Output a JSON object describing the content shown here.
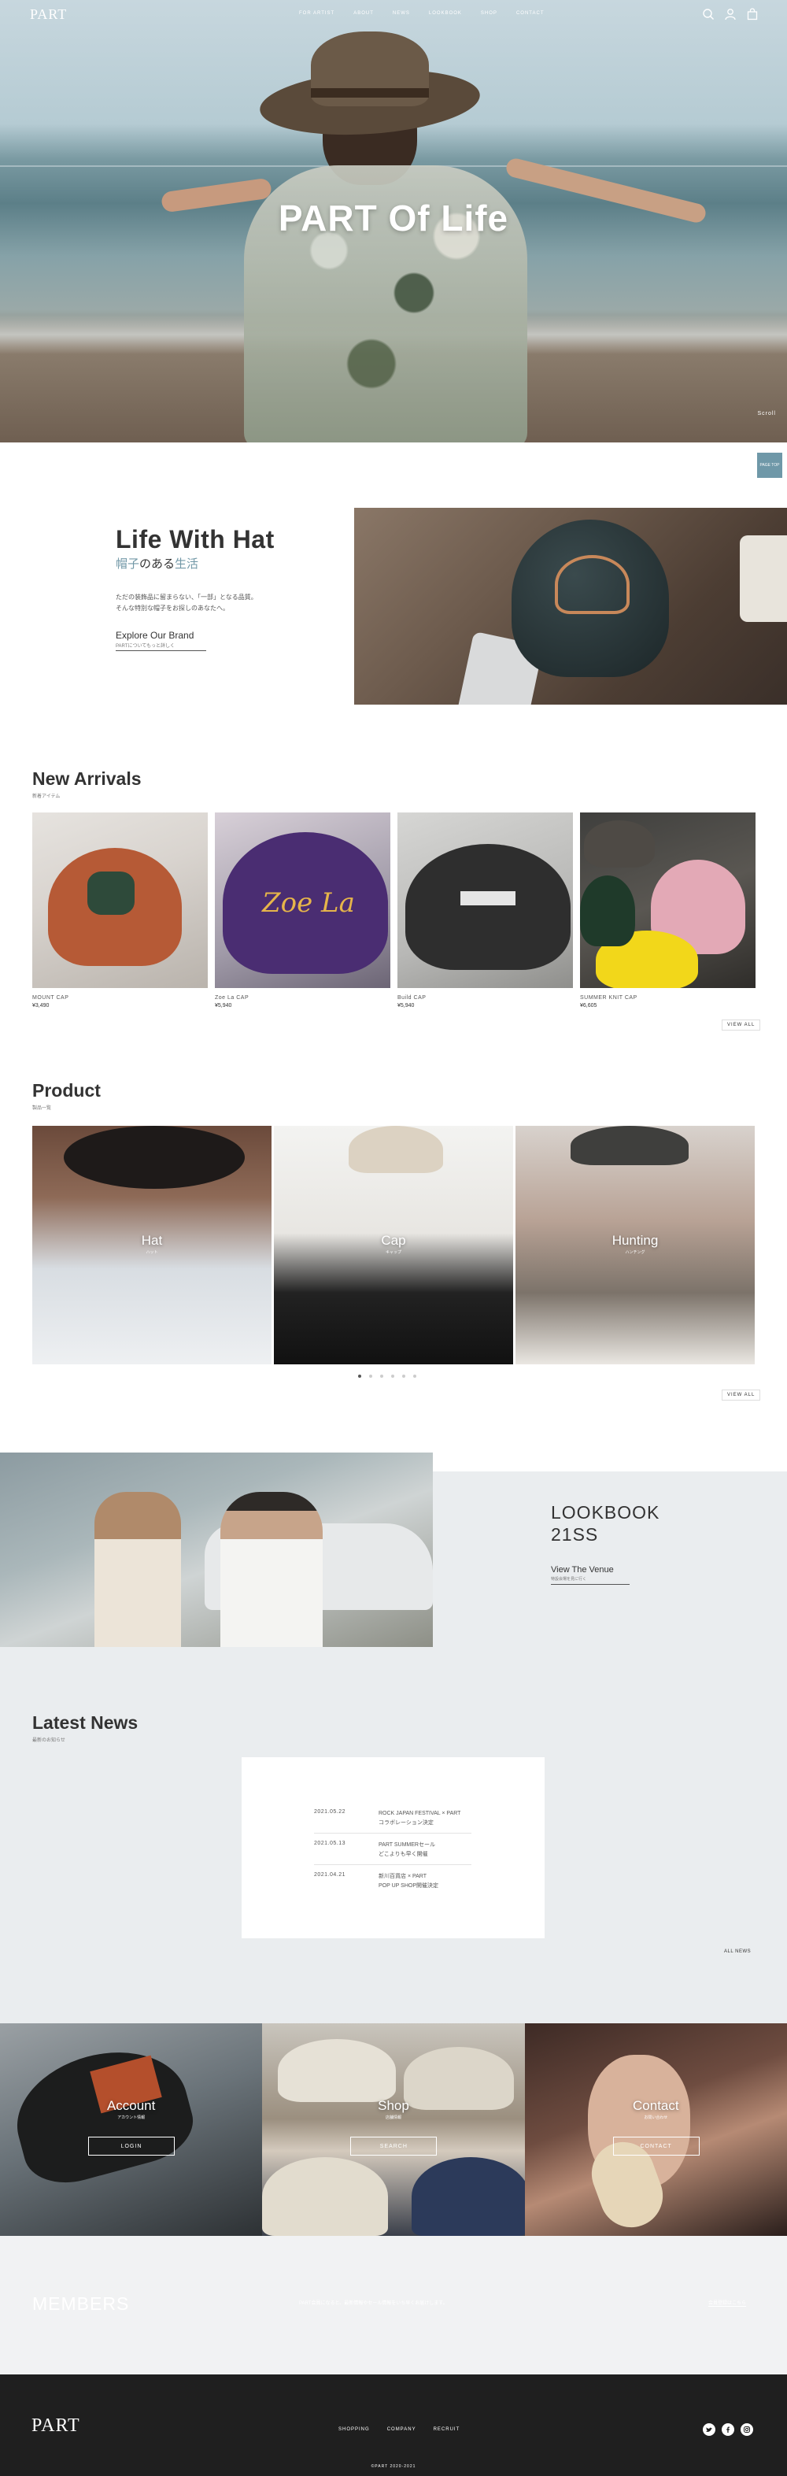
{
  "header": {
    "logo": "PART",
    "nav": [
      "FOR ARTIST",
      "ABOUT",
      "NEWS",
      "LOOKBOOK",
      "SHOP",
      "CONTACT"
    ],
    "icons": [
      "search-icon",
      "user-icon",
      "cart-icon"
    ]
  },
  "hero": {
    "title": "PART Of Life",
    "scroll": "Scroll"
  },
  "page_top": "PAGE TOP",
  "life": {
    "title": "Life With Hat",
    "subtitle_a": "帽子",
    "subtitle_b": "のある",
    "subtitle_c": "生活",
    "desc_1": "ただの装飾品に留まらない、「一部」となる品質。",
    "desc_2": "そんな特別な帽子をお探しのあなたへ。",
    "link": "Explore Our Brand",
    "link_sub": "PARTについてもっと詳しく"
  },
  "arrivals": {
    "title": "New Arrivals",
    "sub": "新着アイテム",
    "items": [
      {
        "name": "MOUNT CAP",
        "price": "¥3,490"
      },
      {
        "name": "Zoe La CAP",
        "price": "¥5,940"
      },
      {
        "name": "Build CAP",
        "price": "¥5,940"
      },
      {
        "name": "SUMMER KNIT CAP",
        "price": "¥6,605"
      }
    ],
    "view_all": "VIEW ALL"
  },
  "product": {
    "title": "Product",
    "sub": "製品一覧",
    "items": [
      {
        "label": "Hat",
        "sub": "ハット"
      },
      {
        "label": "Cap",
        "sub": "キャップ"
      },
      {
        "label": "Hunting",
        "sub": "ハンチング"
      }
    ],
    "view_all": "VIEW ALL"
  },
  "lookbook": {
    "title_1": "LOOKBOOK",
    "title_2": "21SS",
    "link": "View The Venue",
    "link_sub": "特設会場を見に行く"
  },
  "news": {
    "title": "Latest News",
    "sub": "最新のお知らせ",
    "items": [
      {
        "date": "2021.05.22",
        "line1": "ROCK JAPAN FESTIVAL × PART",
        "line2": "コラボレーション決定"
      },
      {
        "date": "2021.05.13",
        "line1": "PART SUMMERセール",
        "line2": "どこよりも早く開催"
      },
      {
        "date": "2021.04.21",
        "line1": "新川百貨店 × PART",
        "line2": "POP UP SHOP開催決定"
      }
    ],
    "all_news": "ALL NEWS"
  },
  "panels": [
    {
      "title": "Account",
      "sub": "アカウント情報",
      "button": "LOGIN"
    },
    {
      "title": "Shop",
      "sub": "店舗情報",
      "button": "SEARCH"
    },
    {
      "title": "Contact",
      "sub": "お問い合わせ",
      "button": "CONTACT"
    }
  ],
  "members": {
    "title": "MEMBERS",
    "text": "PART会員になると、最新情報やセール情報をいち早くお届けします。",
    "button": "会員登録はこちら"
  },
  "footer": {
    "logo": "PART",
    "nav": [
      "SHOPPING",
      "COMPANY",
      "RECRUIT"
    ],
    "social": [
      "twitter-icon",
      "facebook-icon",
      "instagram-icon"
    ],
    "copyright": "©PART 2020-2021"
  },
  "colors": {
    "accent": "#7298a7",
    "page_top": "#6f98a8",
    "footer": "#1f1f1f",
    "light_bg": "#eaedef"
  }
}
